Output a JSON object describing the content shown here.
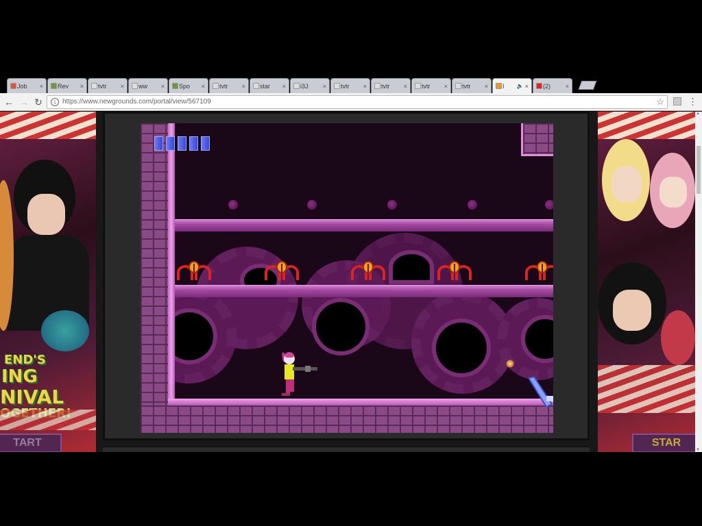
{
  "browser": {
    "tabs": [
      {
        "label": "Job",
        "icon": "red-favicon-icon"
      },
      {
        "label": "Rev",
        "icon": "tv-favicon-icon"
      },
      {
        "label": "tvtr",
        "icon": "page-icon"
      },
      {
        "label": "ww",
        "icon": "page-icon"
      },
      {
        "label": "Spo",
        "icon": "tv-favicon-icon"
      },
      {
        "label": "tvtr",
        "icon": "page-icon"
      },
      {
        "label": "star",
        "icon": "page-icon"
      },
      {
        "label": "i3J",
        "icon": "page-icon"
      },
      {
        "label": "tvtr",
        "icon": "page-icon"
      },
      {
        "label": "tvtr",
        "icon": "page-icon"
      },
      {
        "label": "tvtr",
        "icon": "page-icon"
      },
      {
        "label": "tvtr",
        "icon": "page-icon"
      },
      {
        "label": "I",
        "icon": "newgrounds-favicon-icon",
        "audio": "speaker-icon",
        "active": true
      },
      {
        "label": "(2)",
        "icon": "youtube-favicon-icon"
      }
    ],
    "tab_close_glyph": "×",
    "url": "https://www.newgrounds.com/portal/view/567109",
    "nav": {
      "back": "←",
      "forward": "→",
      "reload": "↻"
    },
    "bookmark_glyph": "☆",
    "menu_glyph": "⋮",
    "info_glyph": "i"
  },
  "ads": {
    "left_text": [
      "END'S",
      "ING",
      "NIVAL",
      "OGETHER!"
    ],
    "left_start": "TART",
    "right_start": "STAR"
  },
  "game": {
    "health_bars": 5,
    "colors": {
      "wall": "#8a4a86",
      "pipe": "#b35ab0",
      "background": "#1a0718",
      "health": "#4a58e6"
    }
  }
}
